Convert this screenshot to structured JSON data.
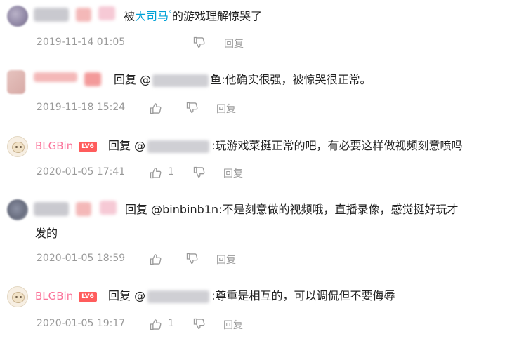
{
  "comments": [
    {
      "text_prefix": "被",
      "mention": "大司马",
      "mention_suffix": "°",
      "text": "的游戏理解惊哭了",
      "time": "2019-11-14 01:05",
      "reply_label": "回复"
    },
    {
      "reply_prefix": "回复 @",
      "partial_name": "鱼",
      "text": ":他确实很强，被惊哭很正常。",
      "time": "2019-11-18 15:24",
      "reply_label": "回复"
    },
    {
      "username": "BLGBin",
      "level": "LV6",
      "reply_prefix": "回复 @",
      "text": ":玩游戏菜挺正常的吧，有必要这样做视频刻意喷吗",
      "time": "2020-01-05 17:41",
      "likes": "1",
      "reply_label": "回复"
    },
    {
      "reply_prefix": "回复",
      "mention_name": "@binbinb1n",
      "text_line1": ":不是刻意做的视频哦，直播录像，感觉挺好玩才",
      "text_line2": "发的",
      "time": "2020-01-05 18:59",
      "reply_label": "回复"
    },
    {
      "username": "BLGBin",
      "level": "LV6",
      "reply_prefix": "回复 @",
      "text": ":尊重是相互的，可以调侃但不要侮辱",
      "time": "2020-01-05 19:17",
      "likes": "1",
      "reply_label": "回复"
    }
  ],
  "colors": {
    "username": "#fb7299",
    "mention_link": "#00a1d6",
    "meta": "#9a9a9a",
    "level_badge": "#ff5c5c"
  },
  "icons": {
    "like": "thumbs-up-icon",
    "dislike": "thumbs-down-icon"
  }
}
